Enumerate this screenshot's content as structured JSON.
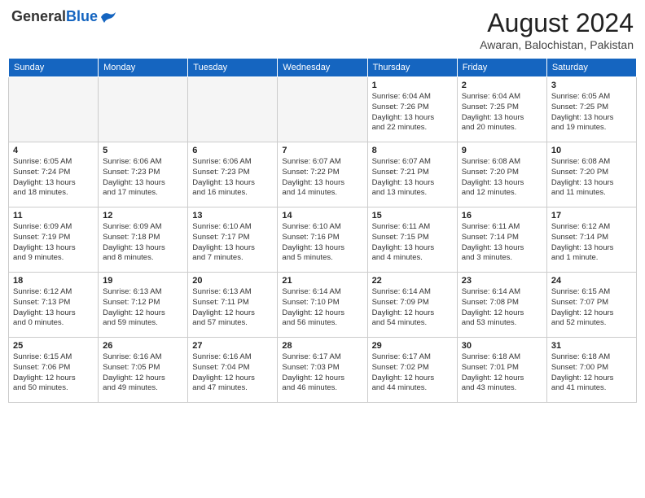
{
  "header": {
    "logo_general": "General",
    "logo_blue": "Blue",
    "month_year": "August 2024",
    "location": "Awaran, Balochistan, Pakistan"
  },
  "weekdays": [
    "Sunday",
    "Monday",
    "Tuesday",
    "Wednesday",
    "Thursday",
    "Friday",
    "Saturday"
  ],
  "weeks": [
    [
      {
        "day": "",
        "info": ""
      },
      {
        "day": "",
        "info": ""
      },
      {
        "day": "",
        "info": ""
      },
      {
        "day": "",
        "info": ""
      },
      {
        "day": "1",
        "info": "Sunrise: 6:04 AM\nSunset: 7:26 PM\nDaylight: 13 hours\nand 22 minutes."
      },
      {
        "day": "2",
        "info": "Sunrise: 6:04 AM\nSunset: 7:25 PM\nDaylight: 13 hours\nand 20 minutes."
      },
      {
        "day": "3",
        "info": "Sunrise: 6:05 AM\nSunset: 7:25 PM\nDaylight: 13 hours\nand 19 minutes."
      }
    ],
    [
      {
        "day": "4",
        "info": "Sunrise: 6:05 AM\nSunset: 7:24 PM\nDaylight: 13 hours\nand 18 minutes."
      },
      {
        "day": "5",
        "info": "Sunrise: 6:06 AM\nSunset: 7:23 PM\nDaylight: 13 hours\nand 17 minutes."
      },
      {
        "day": "6",
        "info": "Sunrise: 6:06 AM\nSunset: 7:23 PM\nDaylight: 13 hours\nand 16 minutes."
      },
      {
        "day": "7",
        "info": "Sunrise: 6:07 AM\nSunset: 7:22 PM\nDaylight: 13 hours\nand 14 minutes."
      },
      {
        "day": "8",
        "info": "Sunrise: 6:07 AM\nSunset: 7:21 PM\nDaylight: 13 hours\nand 13 minutes."
      },
      {
        "day": "9",
        "info": "Sunrise: 6:08 AM\nSunset: 7:20 PM\nDaylight: 13 hours\nand 12 minutes."
      },
      {
        "day": "10",
        "info": "Sunrise: 6:08 AM\nSunset: 7:20 PM\nDaylight: 13 hours\nand 11 minutes."
      }
    ],
    [
      {
        "day": "11",
        "info": "Sunrise: 6:09 AM\nSunset: 7:19 PM\nDaylight: 13 hours\nand 9 minutes."
      },
      {
        "day": "12",
        "info": "Sunrise: 6:09 AM\nSunset: 7:18 PM\nDaylight: 13 hours\nand 8 minutes."
      },
      {
        "day": "13",
        "info": "Sunrise: 6:10 AM\nSunset: 7:17 PM\nDaylight: 13 hours\nand 7 minutes."
      },
      {
        "day": "14",
        "info": "Sunrise: 6:10 AM\nSunset: 7:16 PM\nDaylight: 13 hours\nand 5 minutes."
      },
      {
        "day": "15",
        "info": "Sunrise: 6:11 AM\nSunset: 7:15 PM\nDaylight: 13 hours\nand 4 minutes."
      },
      {
        "day": "16",
        "info": "Sunrise: 6:11 AM\nSunset: 7:14 PM\nDaylight: 13 hours\nand 3 minutes."
      },
      {
        "day": "17",
        "info": "Sunrise: 6:12 AM\nSunset: 7:14 PM\nDaylight: 13 hours\nand 1 minute."
      }
    ],
    [
      {
        "day": "18",
        "info": "Sunrise: 6:12 AM\nSunset: 7:13 PM\nDaylight: 13 hours\nand 0 minutes."
      },
      {
        "day": "19",
        "info": "Sunrise: 6:13 AM\nSunset: 7:12 PM\nDaylight: 12 hours\nand 59 minutes."
      },
      {
        "day": "20",
        "info": "Sunrise: 6:13 AM\nSunset: 7:11 PM\nDaylight: 12 hours\nand 57 minutes."
      },
      {
        "day": "21",
        "info": "Sunrise: 6:14 AM\nSunset: 7:10 PM\nDaylight: 12 hours\nand 56 minutes."
      },
      {
        "day": "22",
        "info": "Sunrise: 6:14 AM\nSunset: 7:09 PM\nDaylight: 12 hours\nand 54 minutes."
      },
      {
        "day": "23",
        "info": "Sunrise: 6:14 AM\nSunset: 7:08 PM\nDaylight: 12 hours\nand 53 minutes."
      },
      {
        "day": "24",
        "info": "Sunrise: 6:15 AM\nSunset: 7:07 PM\nDaylight: 12 hours\nand 52 minutes."
      }
    ],
    [
      {
        "day": "25",
        "info": "Sunrise: 6:15 AM\nSunset: 7:06 PM\nDaylight: 12 hours\nand 50 minutes."
      },
      {
        "day": "26",
        "info": "Sunrise: 6:16 AM\nSunset: 7:05 PM\nDaylight: 12 hours\nand 49 minutes."
      },
      {
        "day": "27",
        "info": "Sunrise: 6:16 AM\nSunset: 7:04 PM\nDaylight: 12 hours\nand 47 minutes."
      },
      {
        "day": "28",
        "info": "Sunrise: 6:17 AM\nSunset: 7:03 PM\nDaylight: 12 hours\nand 46 minutes."
      },
      {
        "day": "29",
        "info": "Sunrise: 6:17 AM\nSunset: 7:02 PM\nDaylight: 12 hours\nand 44 minutes."
      },
      {
        "day": "30",
        "info": "Sunrise: 6:18 AM\nSunset: 7:01 PM\nDaylight: 12 hours\nand 43 minutes."
      },
      {
        "day": "31",
        "info": "Sunrise: 6:18 AM\nSunset: 7:00 PM\nDaylight: 12 hours\nand 41 minutes."
      }
    ]
  ]
}
